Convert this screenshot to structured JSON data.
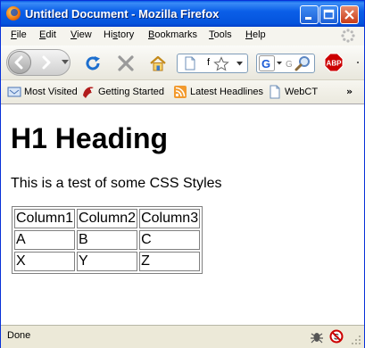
{
  "window": {
    "title": "Untitled Document - Mozilla Firefox"
  },
  "menu": [
    "File",
    "Edit",
    "View",
    "History",
    "Bookmarks",
    "Tools",
    "Help"
  ],
  "menu_underline": [
    "F",
    "E",
    "V",
    "s",
    "B",
    "T",
    "H"
  ],
  "menu_rest": [
    "ile",
    "dit",
    "iew",
    "tory",
    "ookmarks",
    "ools",
    "elp"
  ],
  "menu_prefix": [
    "",
    "",
    "",
    "Hi",
    "",
    "",
    ""
  ],
  "navbar": {
    "url_text": "f"
  },
  "bookmarks": [
    "Most Visited",
    "Getting Started",
    "Latest Headlines",
    "WebCT"
  ],
  "bookmarks_overflow": "»",
  "page": {
    "heading": "H1 Heading",
    "paragraph": "This is a test of some CSS Styles",
    "table": {
      "header": [
        "Column1",
        "Column2",
        "Column3"
      ],
      "rows": [
        [
          "A",
          "B",
          "C"
        ],
        [
          "X",
          "Y",
          "Z"
        ]
      ]
    }
  },
  "status": {
    "text": "Done"
  },
  "icons": {
    "app": "firefox-icon",
    "back": "back-arrow-icon",
    "forward": "forward-arrow-icon",
    "reload": "reload-icon",
    "stop": "stop-icon",
    "home": "home-icon",
    "adblock": "adblock-plus-icon"
  },
  "colors": {
    "titlebar": "#0453dc",
    "reload": "#1d6fce",
    "stop": "#9a9a9a",
    "abp": "#cc0000"
  }
}
